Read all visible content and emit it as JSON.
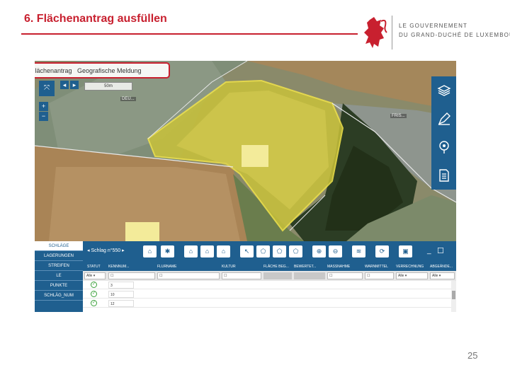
{
  "slide": {
    "title": "6. Flächenantrag ausfüllen",
    "page_number": "25",
    "logo_line1": "LE GOUVERNEMENT",
    "logo_line2": "DU GRAND-DUCHÉ DE LUXEMBOURG"
  },
  "app": {
    "tabs": [
      "Flächenantrag",
      "Geografische Meldung"
    ],
    "map": {
      "scale_text": "50m",
      "labels": [
        "DEU...",
        "FRIS..."
      ],
      "nav_prev": "◂",
      "nav_next": "▸",
      "zoom_in": "+",
      "zoom_out": "−"
    },
    "right_tools": [
      "layers-icon",
      "draw-icon",
      "map-info-icon",
      "document-icon"
    ],
    "sidebar": {
      "items": [
        "SCHLÄGE",
        "LAGERUNGEN",
        "STREIFEN",
        "LE",
        "PUNKTE",
        "SCHLÄG_NUM"
      ]
    },
    "toolbar": {
      "schlag_label": "Schlag",
      "schlag_count": "n°550",
      "minimize": "_",
      "maximize": "☐"
    },
    "table": {
      "headers": [
        "STATUT",
        "KENNNUM...",
        "FLURNAME",
        "KULTUR",
        "FLÄCHE BEG...",
        "BEWERTET...",
        "MASSNAHME",
        "WARNMITTEL",
        "VERRECHNUNG",
        "ABGEÄNDE..."
      ],
      "filter_all": "Alle",
      "rows": [
        {
          "status": "✓",
          "kennnummer": "3"
        },
        {
          "status": "✓",
          "kennnummer": "10"
        },
        {
          "status": "✓",
          "kennnummer": "12"
        }
      ]
    }
  }
}
